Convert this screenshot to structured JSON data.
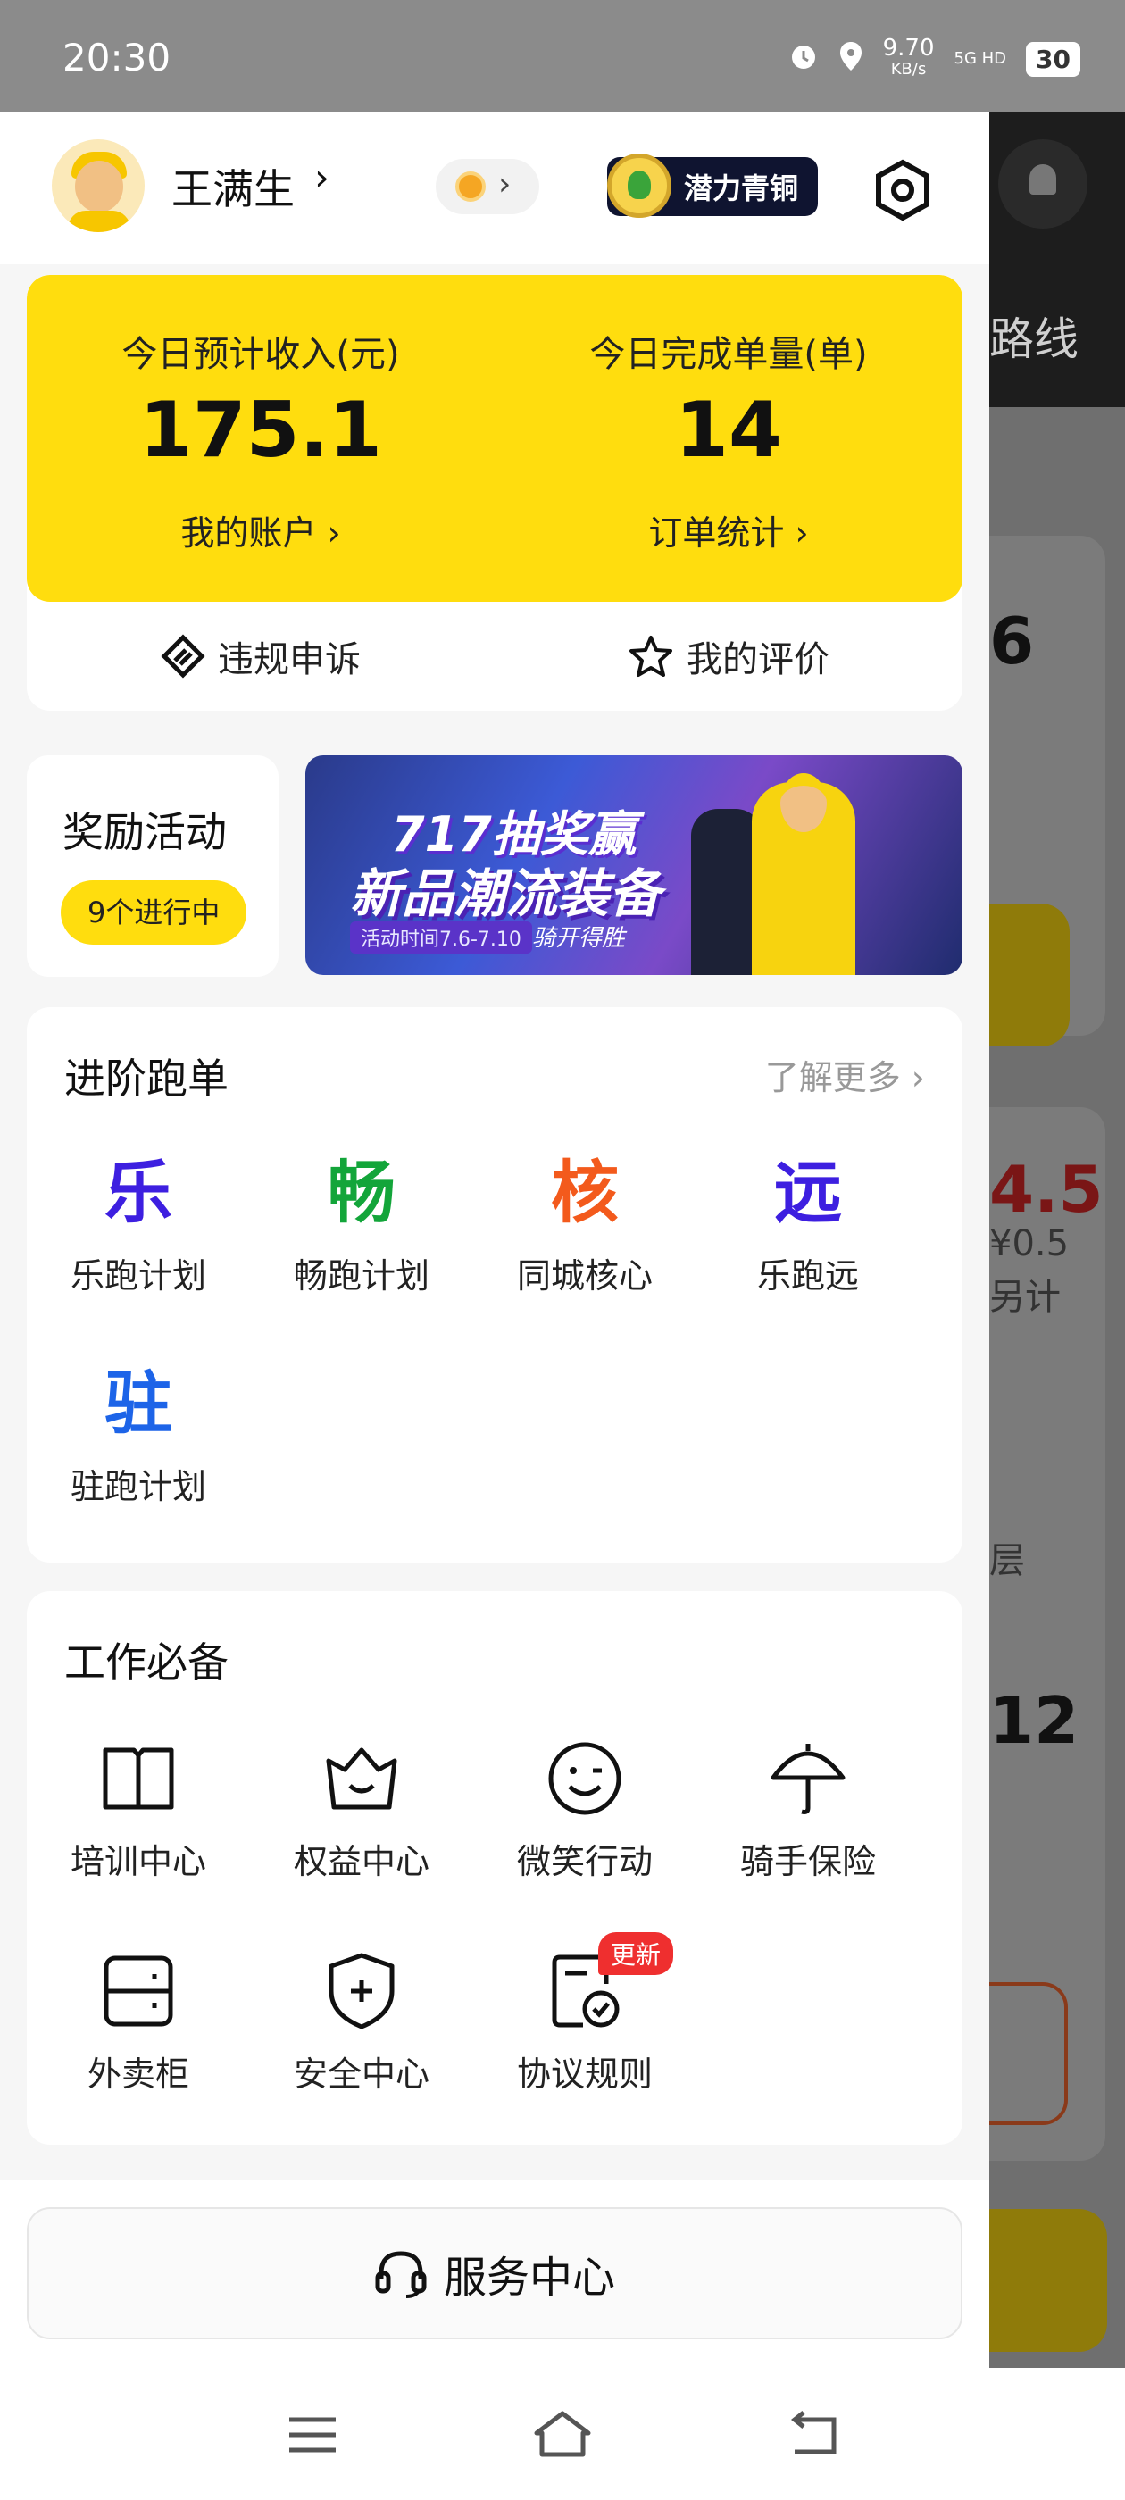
{
  "status_bar": {
    "time": "20:30",
    "net_speed": "9.70",
    "net_unit": "KB/s",
    "signal": "5G HD",
    "battery": "30"
  },
  "profile": {
    "name": "王满生",
    "level_badge": "潜力青铜"
  },
  "income": {
    "left": {
      "title": "今日预计收入(元)",
      "value": "175.1",
      "link": "我的账户"
    },
    "right": {
      "title": "今日完成单量(单)",
      "value": "14",
      "link": "订单统计"
    },
    "actions": [
      {
        "label": "违规申诉",
        "icon": "appeal-icon"
      },
      {
        "label": "我的评价",
        "icon": "star-icon"
      }
    ]
  },
  "rewards": {
    "title": "奖励活动",
    "pill": "9个进行中"
  },
  "banner": {
    "line1": "717抽奖赢",
    "line2": "新品潮流装备",
    "date": "活动时间7.6-7.10",
    "tag": "骑开得胜"
  },
  "advanced": {
    "title": "进阶跑单",
    "more": "了解更多",
    "items": [
      {
        "glyph": "乐",
        "label": "乐跑计划",
        "color": "#3d1fe0"
      },
      {
        "glyph": "畅",
        "label": "畅跑计划",
        "color": "#13a53a"
      },
      {
        "glyph": "核",
        "label": "同城核心",
        "color": "#f35a1c"
      },
      {
        "glyph": "远",
        "label": "乐跑远",
        "color": "#3d1fe0"
      },
      {
        "glyph": "驻",
        "label": "驻跑计划",
        "color": "#1d64e8"
      }
    ]
  },
  "work": {
    "title": "工作必备",
    "items": [
      {
        "label": "培训中心",
        "icon": "book-icon"
      },
      {
        "label": "权益中心",
        "icon": "crown-icon"
      },
      {
        "label": "微笑行动",
        "icon": "smile-icon"
      },
      {
        "label": "骑手保险",
        "icon": "umbrella-icon"
      },
      {
        "label": "外卖柜",
        "icon": "locker-icon"
      },
      {
        "label": "安全中心",
        "icon": "shield-icon"
      },
      {
        "label": "协议规则",
        "icon": "agreement-icon",
        "badge": "更新"
      }
    ]
  },
  "service": {
    "label": "服务中心"
  },
  "background": {
    "route_text": "路线",
    "num1": "6",
    "num2": "4.5",
    "price": "¥0.5",
    "note": "另计",
    "num3": "12",
    "char1": "层"
  }
}
